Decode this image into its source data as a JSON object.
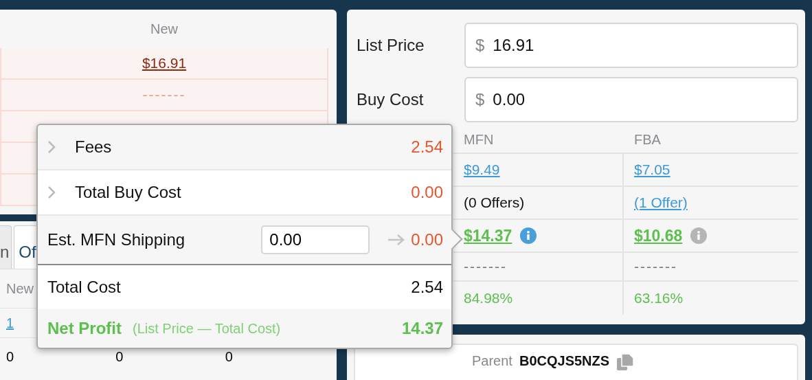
{
  "offers_panel": {
    "column_header": "New",
    "rows": [
      {
        "kind": "link",
        "value": "$16.91"
      },
      {
        "kind": "dash",
        "value": "-------"
      },
      {
        "kind": "empty"
      },
      {
        "kind": "empty"
      },
      {
        "kind": "empty"
      }
    ]
  },
  "lower_panel": {
    "tabs": [
      {
        "label": "n",
        "selected": false
      },
      {
        "label": "Of",
        "selected": true
      }
    ],
    "column_header": "New",
    "rows": [
      [
        {
          "kind": "link",
          "text": "1"
        }
      ],
      [
        {
          "kind": "plain",
          "text": "0"
        },
        {
          "kind": "plain",
          "text": "0"
        },
        {
          "kind": "plain",
          "text": "0"
        }
      ]
    ]
  },
  "calculator": {
    "fields": [
      {
        "label": "List Price",
        "currency": "$",
        "value": "16.91"
      },
      {
        "label": "Buy Cost",
        "currency": "$",
        "value": "0.00"
      }
    ],
    "columns": [
      "MFN",
      "FBA"
    ],
    "rows": [
      {
        "kind": "link",
        "cells": [
          {
            "text": "$9.49"
          },
          {
            "text": "$7.05"
          }
        ]
      },
      {
        "kind": "offers",
        "cells": [
          {
            "text": "(0 Offers)",
            "link": false
          },
          {
            "text": "(1 Offer)",
            "link": true
          }
        ]
      },
      {
        "kind": "profit",
        "cells": [
          {
            "text": "$14.37",
            "selected": true
          },
          {
            "text": "$10.68",
            "selected": false
          }
        ]
      },
      {
        "kind": "dash",
        "cells": [
          {
            "text": "-------"
          },
          {
            "text": "-------"
          }
        ]
      },
      {
        "kind": "percent",
        "cells": [
          {
            "text": "84.98%"
          },
          {
            "text": "63.16%"
          }
        ]
      }
    ]
  },
  "popover": {
    "rows": [
      {
        "kind": "expandable",
        "label": "Fees",
        "value": "2.54"
      },
      {
        "kind": "expandable",
        "label": "Total Buy Cost",
        "value": "0.00"
      },
      {
        "kind": "input",
        "label": "Est. MFN Shipping",
        "input": "0.00",
        "value": "0.00"
      }
    ],
    "total": {
      "label": "Total Cost",
      "value": "2.54"
    },
    "net": {
      "label": "Net Profit",
      "note": "(List Price — Total Cost)",
      "value": "14.37"
    }
  },
  "product": {
    "label": "Parent",
    "value": "B0CQJS5NZS"
  }
}
